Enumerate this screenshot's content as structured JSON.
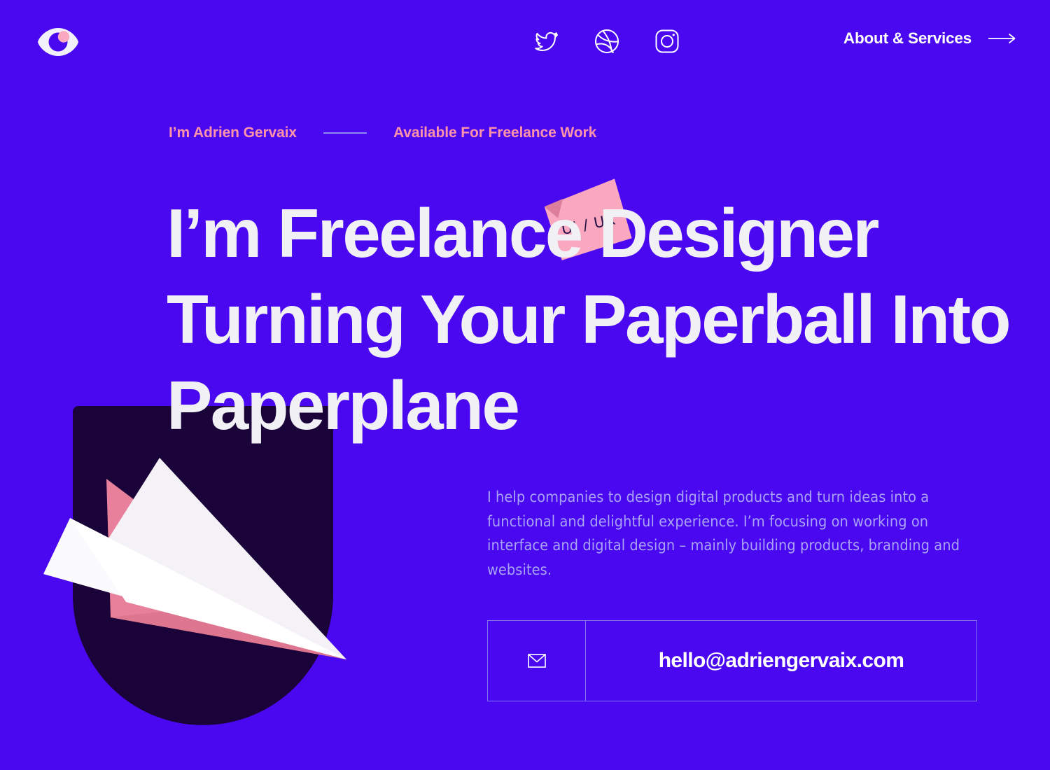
{
  "theme": {
    "background": "#4a08f0",
    "accent_pink": "#fd93ab",
    "illustration_pink": "#e8809c",
    "dark_navy": "#1a0338",
    "headline_white": "#f0f0f5",
    "body_lavender": "#a8a3f5",
    "border_purple": "#8078f0"
  },
  "header": {
    "logo_name": "eye-logo",
    "social": [
      {
        "name": "twitter",
        "label": "Twitter"
      },
      {
        "name": "dribbble",
        "label": "Dribbble"
      },
      {
        "name": "instagram",
        "label": "Instagram"
      }
    ],
    "cta_label": "About & Services",
    "cta_icon": "arrow-right-icon"
  },
  "hero": {
    "eyebrow_name": "I’m Adrien Gervaix",
    "eyebrow_status": "Available For Freelance Work",
    "headline_lines": [
      "I’m Freelance Designer",
      "Turning Your Paperball Into",
      "Paperplane"
    ],
    "sticky_note_label": "UI / UX",
    "bio": "I help companies to design digital products and turn ideas into a functional and delightful experience. I’m focusing on working on interface and digital design – mainly building products, branding and websites."
  },
  "contact": {
    "icon": "envelope-icon",
    "email": "hello@adriengervaix.com"
  },
  "illustration": {
    "name": "paper-plane-arch-illustration",
    "shapes": [
      "dark-arch",
      "paper-plane-white-wings",
      "paper-plane-pink-fold"
    ]
  }
}
